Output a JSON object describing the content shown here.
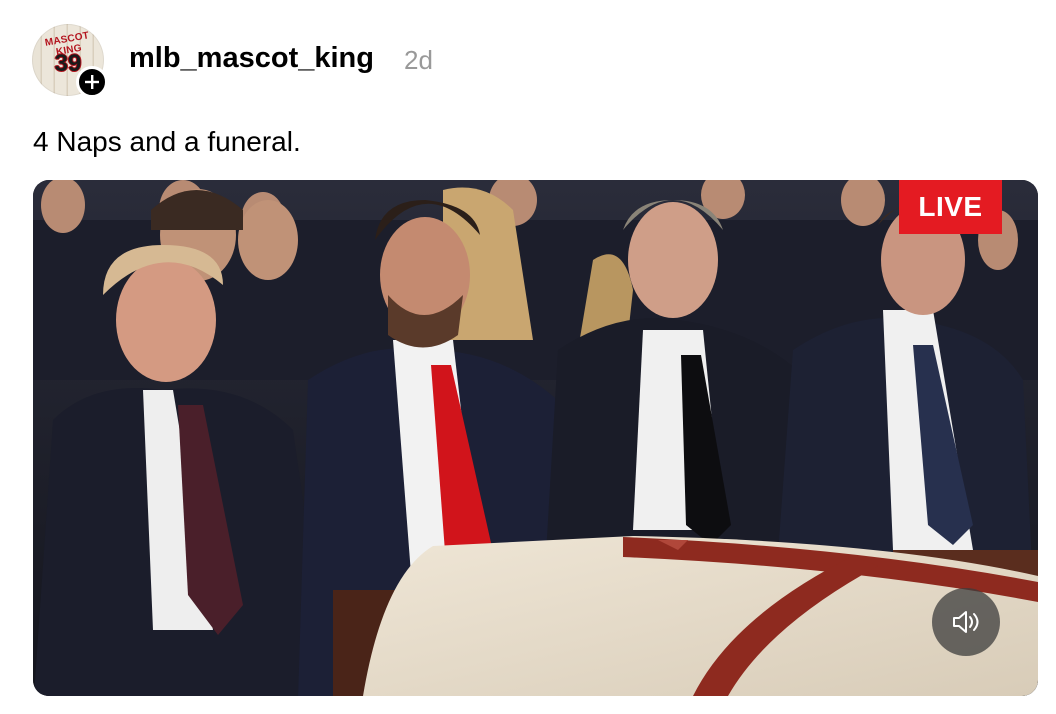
{
  "post": {
    "username": "mlb_mascot_king",
    "time_ago": "2d",
    "caption": "4 Naps and a funeral.",
    "avatar": {
      "text": "MASCOT KING",
      "number": "39",
      "icon": "avatar-jersey"
    },
    "follow_icon": "plus-icon"
  },
  "video": {
    "live_label": "LIVE",
    "mute_icon": "speaker-icon",
    "description_colors": {
      "live_badge": "#e41b22",
      "pew_wood": "#5a2d1e",
      "casket_drape": "#e6dccb",
      "drape_trim": "#8e2a1f"
    }
  }
}
